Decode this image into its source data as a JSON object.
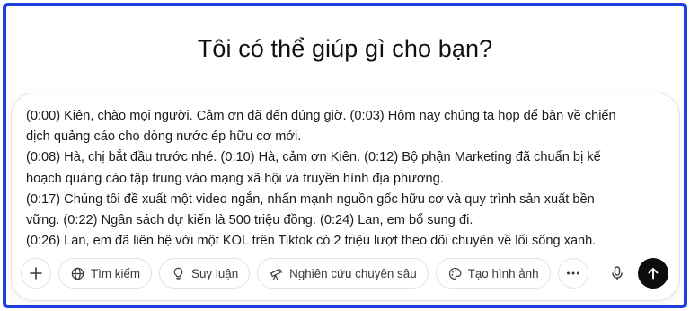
{
  "heading": "Tôi có thể giúp gì cho bạn?",
  "composer": {
    "prompt_lines": [
      "(0:00) Kiên, chào mọi người. Cảm ơn đã đến đúng giờ. (0:03) Hôm nay chúng ta họp để bàn về chiến",
      "dịch quảng cáo cho dòng nước ép hữu cơ mới.",
      "(0:08) Hà, chị bắt đầu trước nhé. (0:10) Hà, cảm ơn Kiên. (0:12) Bộ phận Marketing đã chuẩn bị kế",
      "hoạch quảng cáo tập trung vào mạng xã hội và truyền hình địa phương.",
      "(0:17) Chúng tôi đề xuất một video ngắn, nhấn mạnh nguồn gốc hữu cơ và quy trình sản xuất bền",
      "vững. (0:22) Ngân sách dự kiến là 500 triệu đồng. (0:24) Lan, em bổ sung đi.",
      "(0:26) Lan, em đã liên hệ với một KOL trên Tiktok có 2 triệu lượt theo dõi chuyên về lối sống xanh."
    ]
  },
  "toolbar": {
    "search_label": "Tìm kiếm",
    "reason_label": "Suy luận",
    "research_label": "Nghiên cứu chuyên sâu",
    "image_label": "Tạo hình ảnh"
  },
  "icons": {
    "add": "plus-icon",
    "search": "globe-icon",
    "reason": "lightbulb-icon",
    "research": "telescope-icon",
    "image": "palette-icon",
    "more": "more-icon",
    "mic": "microphone-icon",
    "send": "arrow-up-icon"
  },
  "colors": {
    "frame_border": "#1f3fe0",
    "send_button": "#0d0d0d"
  }
}
